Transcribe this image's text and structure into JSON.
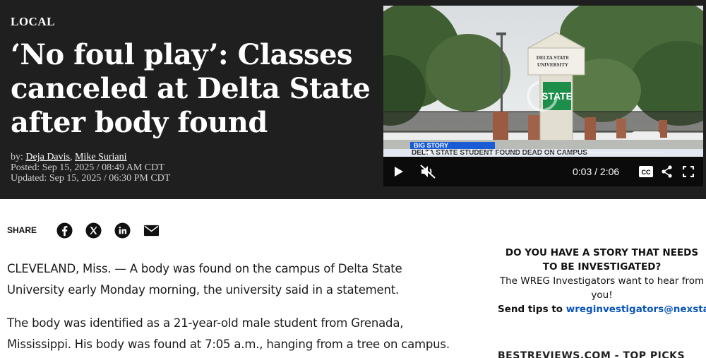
{
  "hero": {
    "category": "LOCAL",
    "headline_lines": [
      "‘No foul play’: Classes",
      "canceled at Delta State",
      "after body found"
    ],
    "byline_prefix": "by: ",
    "author_1": "Deja Davis",
    "byline_sep": ", ",
    "author_2": "Mike Suriani",
    "posted": "Posted: Sep 15, 2025 / 08:49 AM CDT",
    "updated": "Updated: Sep 15, 2025 / 06:30 PM CDT"
  },
  "video": {
    "sign_line_1": "DELTA STATE",
    "sign_line_2": "UNIVERSITY",
    "big_story": "BIG STORY",
    "ticker": "DELTA STATE STUDENT FOUND DEAD ON CAMPUS",
    "current_time": "0:03",
    "duration": "/ 2:06",
    "progress_fraction": 0.024,
    "icons": {
      "play": "play-icon",
      "mute": "muted-icon",
      "cc": "closed-captions-icon",
      "share": "share-icon",
      "fullscreen": "fullscreen-icon"
    }
  },
  "share": {
    "label": "SHARE",
    "icons": [
      "facebook-icon",
      "x-icon",
      "linkedin-icon",
      "email-icon"
    ]
  },
  "article": {
    "paragraphs": [
      "CLEVELAND, Miss. — A body was found on the campus of Delta State University early Monday morning, the university said in a statement.",
      "The body was identified as a 21-year-old male student from Grenada, Mississippi. His body was found at 7:05 a.m., hanging from a tree on campus."
    ]
  },
  "sidebar": {
    "heading_line_1": "DO YOU HAVE A STORY THAT NEEDS",
    "heading_line_2": "TO BE INVESTIGATED?",
    "text": "The WREG Investigators want to hear from you!",
    "tips_prefix": "Send tips to ",
    "tips_email": "wreginvestigators@nexstar.tv",
    "next_section": "BESTREVIEWS.COM - TOP PICKS"
  },
  "colors": {
    "hero_bg": "#1f1f1f",
    "link_blue": "#0a55b8",
    "big_story_blue": "#1a5bd6"
  }
}
